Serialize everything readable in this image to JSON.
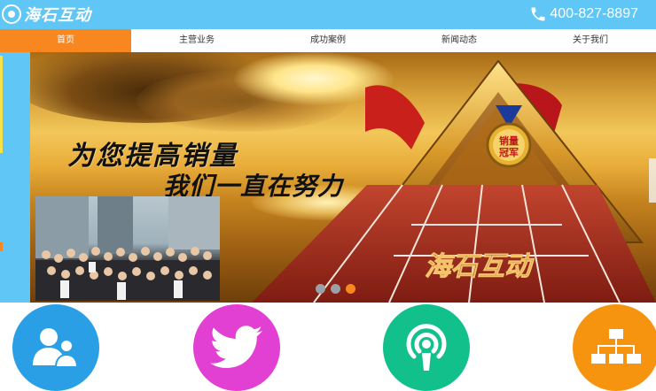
{
  "header": {
    "logo_text": "海石互动",
    "phone": "400-827-8897"
  },
  "nav": {
    "items": [
      {
        "label": "首页",
        "active": true
      },
      {
        "label": "主营业务",
        "active": false
      },
      {
        "label": "成功案例",
        "active": false
      },
      {
        "label": "新闻动态",
        "active": false
      },
      {
        "label": "关于我们",
        "active": false
      }
    ]
  },
  "banner": {
    "slogan_line1": "为您提高销量",
    "slogan_line2": "我们一直在努力",
    "medal_text_top": "销量",
    "medal_text_bottom": "冠军",
    "track_text": "海石互动",
    "slide_count": 3,
    "active_slide": 3
  },
  "features": [
    {
      "icon": "users-icon",
      "color": "#2a9fe6"
    },
    {
      "icon": "twitter-bird-icon",
      "color": "#e23fd3"
    },
    {
      "icon": "podcast-icon",
      "color": "#12c08c"
    },
    {
      "icon": "sitemap-icon",
      "color": "#f7940f"
    }
  ],
  "colors": {
    "header_bg": "#5fc6f5",
    "nav_active": "#f7871e"
  }
}
